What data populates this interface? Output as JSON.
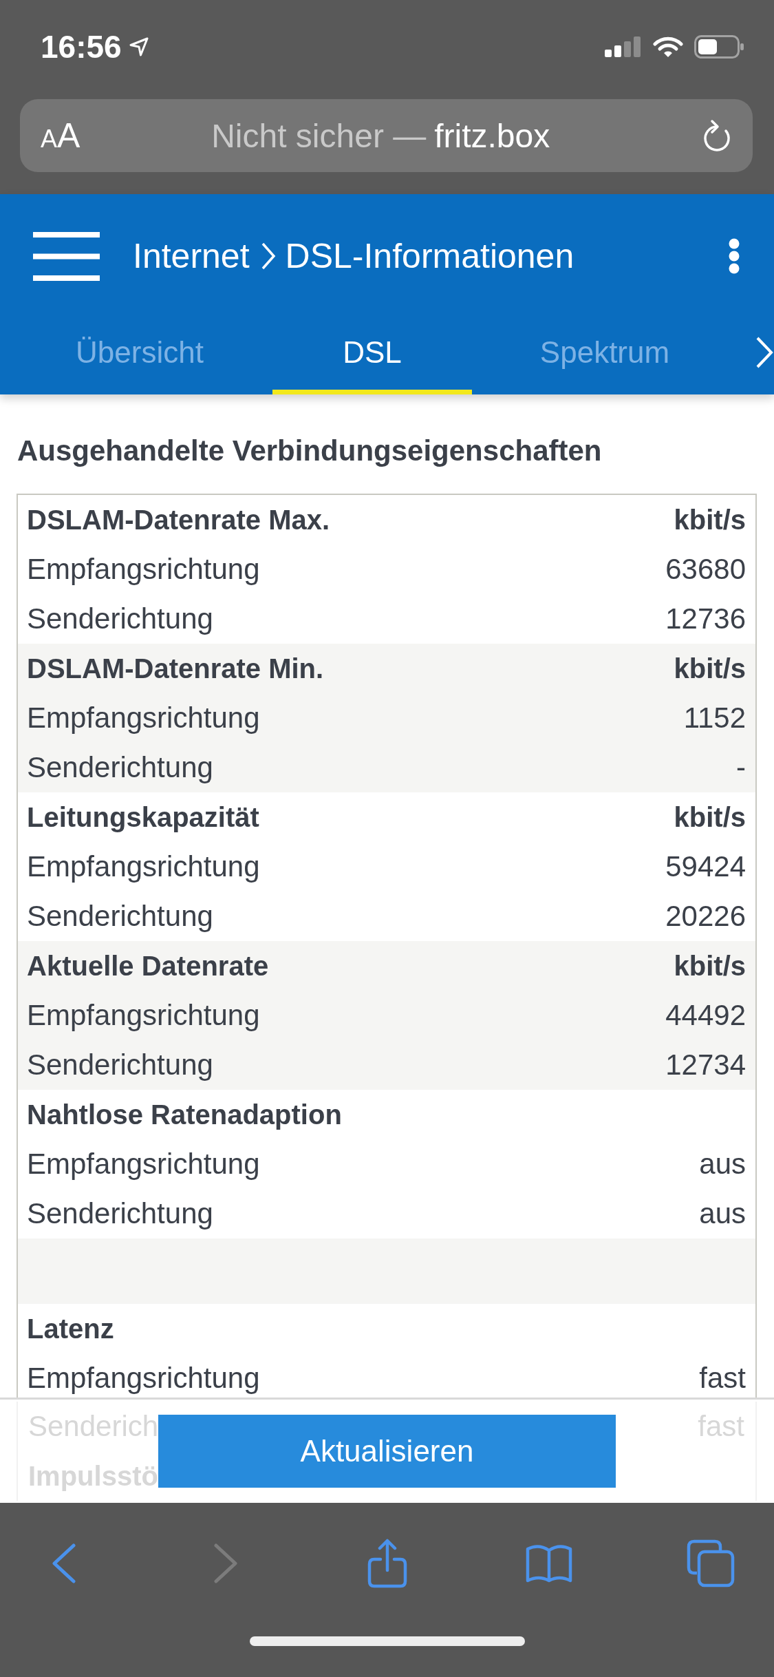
{
  "status_bar": {
    "time": "16:56"
  },
  "address_bar": {
    "text_size_button": "AA",
    "security_label": "Nicht sicher —",
    "host": "fritz.box"
  },
  "header": {
    "breadcrumb": [
      "Internet",
      "DSL-Informationen"
    ],
    "tabs": [
      {
        "label": "Übersicht",
        "selected": false
      },
      {
        "label": "DSL",
        "selected": true
      },
      {
        "label": "Spektrum",
        "selected": false
      }
    ]
  },
  "section": {
    "title": "Ausgehandelte Verbindungseigenschaften",
    "groups": [
      {
        "kind": "group",
        "heading": "DSLAM-Datenrate Max.",
        "unit": "kbit/s",
        "rows": [
          {
            "label": "Empfangsrichtung",
            "value": "63680"
          },
          {
            "label": "Senderichtung",
            "value": "12736"
          }
        ]
      },
      {
        "kind": "group",
        "heading": "DSLAM-Datenrate Min.",
        "unit": "kbit/s",
        "rows": [
          {
            "label": "Empfangsrichtung",
            "value": "1152"
          },
          {
            "label": "Senderichtung",
            "value": "-"
          }
        ]
      },
      {
        "kind": "group",
        "heading": "Leitungskapazität",
        "unit": "kbit/s",
        "rows": [
          {
            "label": "Empfangsrichtung",
            "value": "59424"
          },
          {
            "label": "Senderichtung",
            "value": "20226"
          }
        ]
      },
      {
        "kind": "group",
        "heading": "Aktuelle Datenrate",
        "unit": "kbit/s",
        "rows": [
          {
            "label": "Empfangsrichtung",
            "value": "44492"
          },
          {
            "label": "Senderichtung",
            "value": "12734"
          }
        ]
      },
      {
        "kind": "group",
        "heading": "Nahtlose Ratenadaption",
        "rows": [
          {
            "label": "Empfangsrichtung",
            "value": "aus"
          },
          {
            "label": "Senderichtung",
            "value": "aus"
          }
        ]
      },
      {
        "kind": "blank"
      },
      {
        "kind": "group",
        "heading": "Latenz",
        "rows": [
          {
            "label": "Empfangsrichtung",
            "value": "fast"
          }
        ]
      }
    ]
  },
  "action_bar": {
    "rows_beneath": [
      {
        "kind": "row",
        "label": "Senderich",
        "value": "fast"
      },
      {
        "kind": "heading",
        "label": "Impulsstö"
      }
    ],
    "button": "Aktualisieren"
  },
  "toolbar": {
    "buttons": [
      {
        "kind": "back",
        "disabled": false
      },
      {
        "kind": "forward",
        "disabled": true
      },
      {
        "kind": "share",
        "disabled": false
      },
      {
        "kind": "bookmarks",
        "disabled": false
      },
      {
        "kind": "tabs",
        "disabled": false
      }
    ]
  }
}
